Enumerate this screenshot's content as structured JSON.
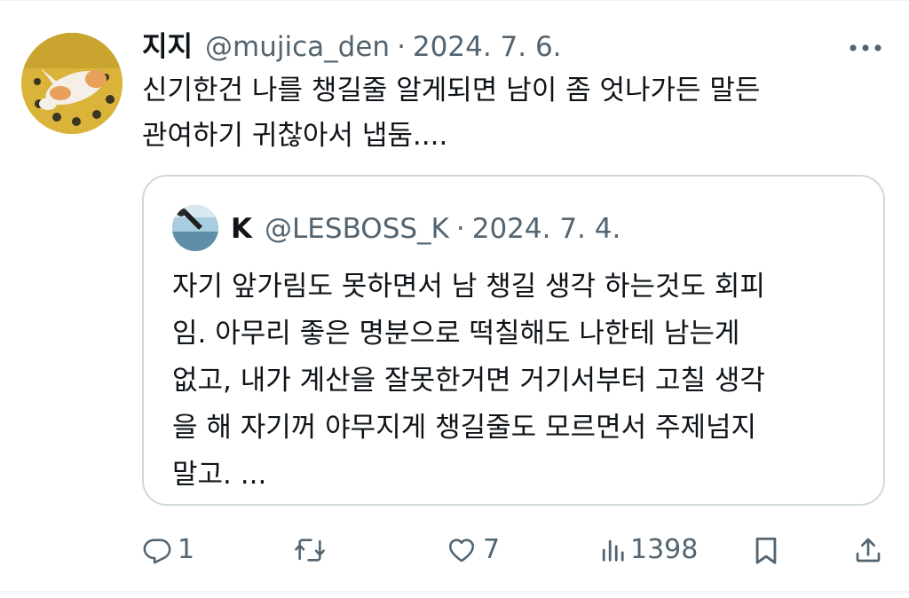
{
  "tweet": {
    "display_name": "지지",
    "handle": "@mujica_den",
    "separator": "·",
    "date": "2024. 7. 6.",
    "text": "신기한건 나를 챙길줄 알게되면 남이 좀 엇나가든 말든\n관여하기 귀찮아서 냅둠....",
    "avatar_icon": "cat-photo-avatar",
    "more_icon": "more-horizontal-icon"
  },
  "quote": {
    "display_name": "K",
    "handle": "@LESBOSS_K",
    "separator": "·",
    "date": "2024. 7. 4.",
    "text": "자기 앞가림도 못하면서 남 챙길 생각 하는것도 회피\n임. 아무리 좋은 명분으로 떡칠해도 나한테 남는게\n없고, 내가 계산을 잘못한거면 거기서부터 고칠 생각\n을 해 자기꺼 야무지게 챙길줄도 모르면서 주제넘지\n말고. ...",
    "avatar_icon": "sky-photo-avatar"
  },
  "actions": {
    "reply_count": "1",
    "retweet_count": "",
    "like_count": "7",
    "views_count": "1398",
    "reply_icon": "reply-icon",
    "retweet_icon": "retweet-icon",
    "like_icon": "heart-icon",
    "views_icon": "views-chart-icon",
    "bookmark_icon": "bookmark-icon",
    "share_icon": "share-icon"
  },
  "colors": {
    "text_primary": "#0f1419",
    "text_secondary": "#536471",
    "border": "#cfd9de"
  }
}
